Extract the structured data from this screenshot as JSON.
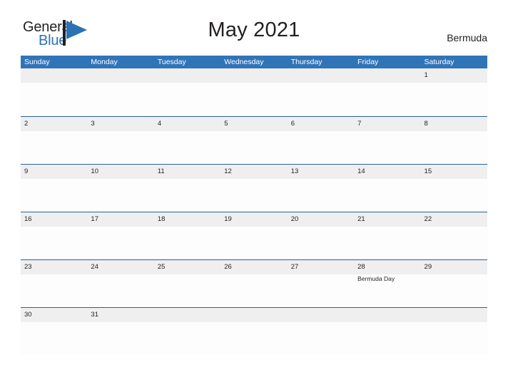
{
  "brand": {
    "word_one": "General",
    "word_two": "Blue",
    "flag_icon": "flag-triangle-icon",
    "color_dark": "#231f20",
    "color_blue": "#2b72b4"
  },
  "header": {
    "title": "May 2021",
    "country": "Bermuda"
  },
  "theme": {
    "header_blue": "#3074b8",
    "rule_blue": "#2a6099",
    "band_gray": "#efefef",
    "cell_white": "#fdfdfd"
  },
  "calendar": {
    "month": "May",
    "year": "2021",
    "weekdays": [
      "Sunday",
      "Monday",
      "Tuesday",
      "Wednesday",
      "Thursday",
      "Friday",
      "Saturday"
    ],
    "weeks": [
      {
        "days": [
          {
            "num": "",
            "event": ""
          },
          {
            "num": "",
            "event": ""
          },
          {
            "num": "",
            "event": ""
          },
          {
            "num": "",
            "event": ""
          },
          {
            "num": "",
            "event": ""
          },
          {
            "num": "",
            "event": ""
          },
          {
            "num": "1",
            "event": ""
          }
        ]
      },
      {
        "days": [
          {
            "num": "2",
            "event": ""
          },
          {
            "num": "3",
            "event": ""
          },
          {
            "num": "4",
            "event": ""
          },
          {
            "num": "5",
            "event": ""
          },
          {
            "num": "6",
            "event": ""
          },
          {
            "num": "7",
            "event": ""
          },
          {
            "num": "8",
            "event": ""
          }
        ]
      },
      {
        "days": [
          {
            "num": "9",
            "event": ""
          },
          {
            "num": "10",
            "event": ""
          },
          {
            "num": "11",
            "event": ""
          },
          {
            "num": "12",
            "event": ""
          },
          {
            "num": "13",
            "event": ""
          },
          {
            "num": "14",
            "event": ""
          },
          {
            "num": "15",
            "event": ""
          }
        ]
      },
      {
        "days": [
          {
            "num": "16",
            "event": ""
          },
          {
            "num": "17",
            "event": ""
          },
          {
            "num": "18",
            "event": ""
          },
          {
            "num": "19",
            "event": ""
          },
          {
            "num": "20",
            "event": ""
          },
          {
            "num": "21",
            "event": ""
          },
          {
            "num": "22",
            "event": ""
          }
        ]
      },
      {
        "days": [
          {
            "num": "23",
            "event": ""
          },
          {
            "num": "24",
            "event": ""
          },
          {
            "num": "25",
            "event": ""
          },
          {
            "num": "26",
            "event": ""
          },
          {
            "num": "27",
            "event": ""
          },
          {
            "num": "28",
            "event": "Bermuda Day"
          },
          {
            "num": "29",
            "event": ""
          }
        ]
      },
      {
        "days": [
          {
            "num": "30",
            "event": ""
          },
          {
            "num": "31",
            "event": ""
          },
          {
            "num": "",
            "event": ""
          },
          {
            "num": "",
            "event": ""
          },
          {
            "num": "",
            "event": ""
          },
          {
            "num": "",
            "event": ""
          },
          {
            "num": "",
            "event": ""
          }
        ]
      }
    ]
  }
}
